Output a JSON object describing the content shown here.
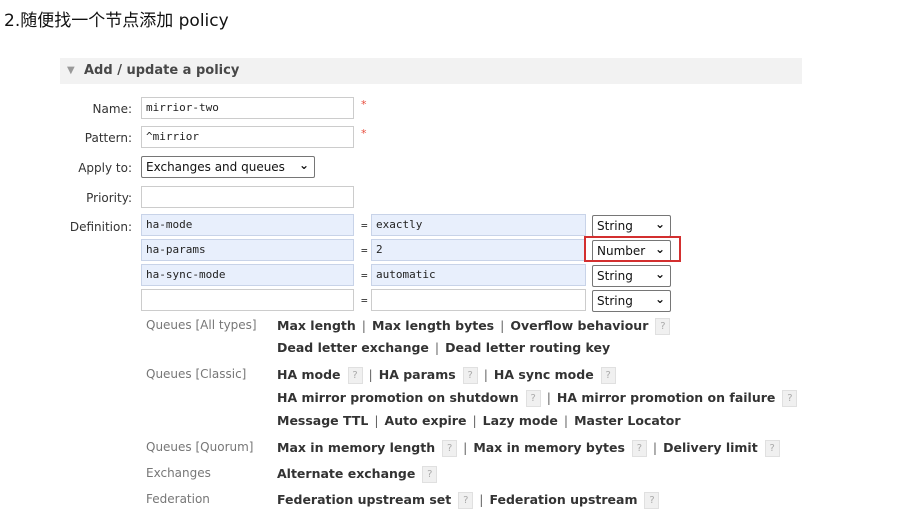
{
  "heading": "2.随便找一个节点添加 policy",
  "section": {
    "title": "Add / update a policy"
  },
  "form": {
    "name_label": "Name:",
    "name_value": "mirrior-two",
    "pattern_label": "Pattern:",
    "pattern_value": "^mirrior",
    "apply_label": "Apply to:",
    "apply_value": "Exchanges and queues",
    "priority_label": "Priority:",
    "priority_value": "",
    "definition_label": "Definition:",
    "required_mark": "*",
    "definitions": [
      {
        "key": "ha-mode",
        "eq": "=",
        "value": "exactly",
        "type": "String"
      },
      {
        "key": "ha-params",
        "eq": "=",
        "value": "2",
        "type": "Number"
      },
      {
        "key": "ha-sync-mode",
        "eq": "=",
        "value": "automatic",
        "type": "String"
      },
      {
        "key": "",
        "eq": "=",
        "value": "",
        "type": "String"
      }
    ]
  },
  "help": {
    "queues_all": "Queues [All types]",
    "queues_all_line1": [
      "Max length",
      "Max length bytes",
      "Overflow behaviour"
    ],
    "queues_all_line2": [
      "Dead letter exchange",
      "Dead letter routing key"
    ],
    "queues_classic": "Queues [Classic]",
    "classic_line1": [
      "HA mode",
      "HA params",
      "HA sync mode"
    ],
    "classic_line2": [
      "HA mirror promotion on shutdown",
      "HA mirror promotion on failure"
    ],
    "classic_line3": [
      "Message TTL",
      "Auto expire",
      "Lazy mode",
      "Master Locator"
    ],
    "queues_quorum": "Queues [Quorum]",
    "quorum_line1": [
      "Max in memory length",
      "Max in memory bytes",
      "Delivery limit"
    ],
    "exchanges": "Exchanges",
    "exchanges_line1": [
      "Alternate exchange"
    ],
    "federation": "Federation",
    "federation_line1": [
      "Federation upstream set",
      "Federation upstream"
    ],
    "help_mark": "?",
    "separator": "|"
  }
}
